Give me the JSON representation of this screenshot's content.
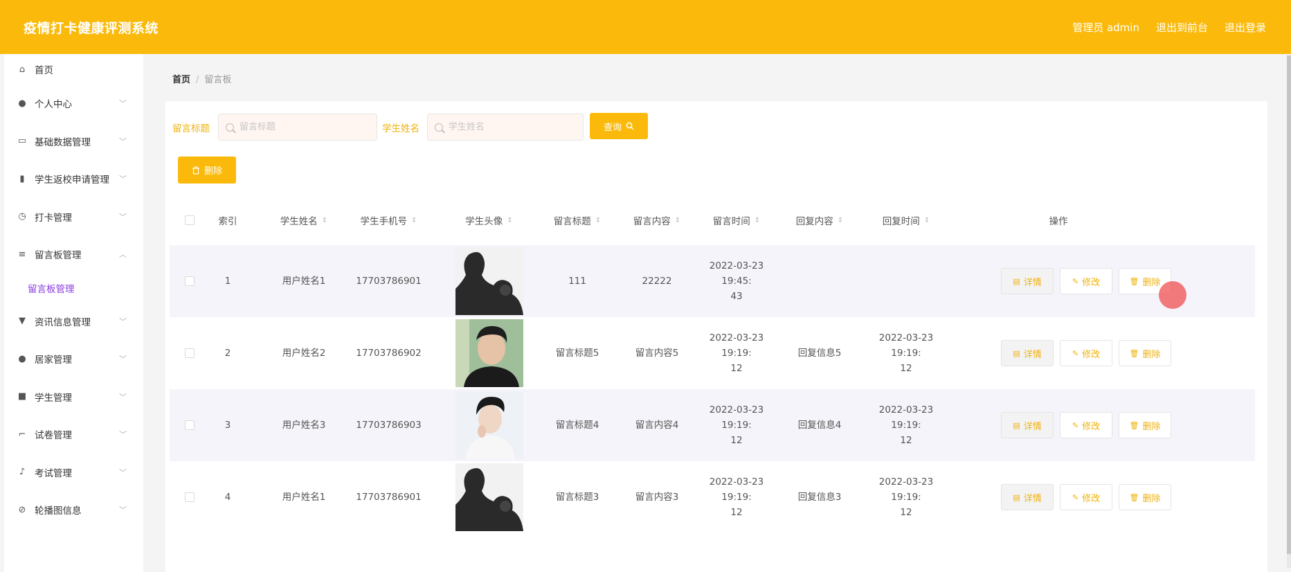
{
  "app": {
    "title": "疫情打卡健康评测系统",
    "admin_label": "管理员 admin",
    "front_link": "退出到前台",
    "logout_link": "退出登录"
  },
  "colors": {
    "accent": "#fbba0b",
    "active_submenu": "#8a3be0"
  },
  "sidebar": {
    "items": [
      {
        "label": "首页",
        "icon": "home-icon"
      },
      {
        "label": "个人中心",
        "icon": "user-icon"
      },
      {
        "label": "基础数据管理",
        "icon": "id-card-icon"
      },
      {
        "label": "学生返校申请管理",
        "icon": "bar-chart-icon"
      },
      {
        "label": "打卡管理",
        "icon": "clock-icon"
      },
      {
        "label": "留言板管理",
        "icon": "sliders-icon"
      },
      {
        "label": "资讯信息管理",
        "icon": "stamp-icon"
      },
      {
        "label": "居家管理",
        "icon": "user-icon"
      },
      {
        "label": "学生管理",
        "icon": "gamepad-icon"
      },
      {
        "label": "试卷管理",
        "icon": "crop-icon"
      },
      {
        "label": "考试管理",
        "icon": "microphone-icon"
      },
      {
        "label": "轮播图信息",
        "icon": "slash-icon"
      }
    ],
    "active_sub": "留言板管理"
  },
  "breadcrumb": {
    "home": "首页",
    "current": "留言板"
  },
  "search": {
    "title_label": "留言标题",
    "title_placeholder": "留言标题",
    "name_label": "学生姓名",
    "name_placeholder": "学生姓名",
    "query_button": "查询",
    "delete_button": "删除"
  },
  "table": {
    "headers": [
      "索引",
      "学生姓名",
      "学生手机号",
      "学生头像",
      "留言标题",
      "留言内容",
      "留言时间",
      "回复内容",
      "回复时间",
      "操作"
    ],
    "rows": [
      {
        "index": "1",
        "name": "用户姓名1",
        "phone": "17703786901",
        "avatar": "silhouette",
        "title": "111",
        "content": "22222",
        "time_1": "2022-03-23 19:45:",
        "time_2": "43",
        "reply": "",
        "reply_time_1": "",
        "reply_time_2": ""
      },
      {
        "index": "2",
        "name": "用户姓名2",
        "phone": "17703786902",
        "avatar": "portrait-dark",
        "title": "留言标题5",
        "content": "留言内容5",
        "time_1": "2022-03-23 19:19:",
        "time_2": "12",
        "reply": "回复信息5",
        "reply_time_1": "2022-03-23 19:19:",
        "reply_time_2": "12"
      },
      {
        "index": "3",
        "name": "用户姓名3",
        "phone": "17703786903",
        "avatar": "portrait-light",
        "title": "留言标题4",
        "content": "留言内容4",
        "time_1": "2022-03-23 19:19:",
        "time_2": "12",
        "reply": "回复信息4",
        "reply_time_1": "2022-03-23 19:19:",
        "reply_time_2": "12"
      },
      {
        "index": "4",
        "name": "用户姓名1",
        "phone": "17703786901",
        "avatar": "silhouette",
        "title": "留言标题3",
        "content": "留言内容3",
        "time_1": "2022-03-23 19:19:",
        "time_2": "12",
        "reply": "回复信息3",
        "reply_time_1": "2022-03-23 19:19:",
        "reply_time_2": "12"
      }
    ],
    "actions": {
      "detail": "详情",
      "edit": "修改",
      "delete": "删除"
    }
  }
}
